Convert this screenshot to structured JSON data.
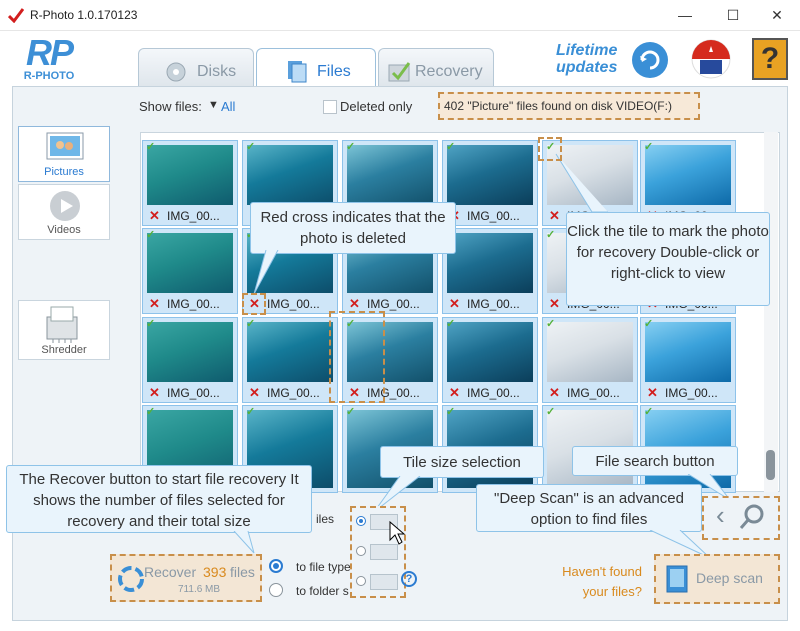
{
  "window": {
    "title": "R-Photo 1.0.170123",
    "minimize": "—",
    "maximize": "☐",
    "close": "✕"
  },
  "logo": {
    "text": "RP",
    "subtext": "R-PHOTO"
  },
  "tabs": [
    {
      "label": "Disks"
    },
    {
      "label": "Files"
    },
    {
      "label": "Recovery"
    }
  ],
  "header": {
    "lifetime_line1": "Lifetime",
    "lifetime_line2": "updates",
    "help": "?"
  },
  "filter": {
    "show_files_label": "Show files:",
    "show_files_value": "All",
    "deleted_only": "Deleted only",
    "status": "402 \"Picture\" files found on disk VIDEO(F:)"
  },
  "sidebar": [
    {
      "label": "Pictures"
    },
    {
      "label": "Videos"
    },
    {
      "label": "Shredder"
    }
  ],
  "tile_label": "IMG_00...",
  "tile_check": "✓",
  "tile_cross": "✕",
  "callouts": {
    "red_cross": "Red cross indicates that the photo is deleted",
    "mark_tile": "Click the tile to mark the photo for recovery Double-click or right-click to view",
    "recover_btn": "The Recover button to start file recovery It shows the number of files selected for recovery and their total size",
    "tile_size": "Tile size selection",
    "file_search": "File search button",
    "deep_scan_info": "\"Deep Scan\" is an advanced option to find files"
  },
  "bottom": {
    "recover_prefix": "Recover",
    "recover_count": "393",
    "recover_suffix": "files",
    "recover_size": "711.6 MB",
    "files_fragment": "iles",
    "to_file_type": "to file type",
    "to_folder": "to folder s",
    "help_q": "?",
    "havent_found_1": "Haven't found",
    "havent_found_2": "your files?",
    "deep_scan": "Deep scan"
  },
  "colors": {
    "accent": "#2b7bd1",
    "deleted": "#d21e1e",
    "orange": "#d98a1e",
    "tile_bg": "#cfe6f8",
    "callout_border": "#8ec3e8"
  }
}
